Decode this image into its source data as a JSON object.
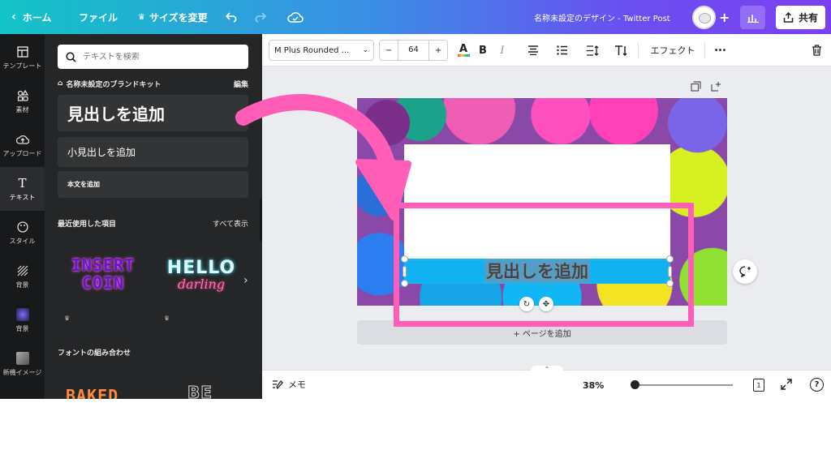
{
  "topbar": {
    "home": "ホーム",
    "file": "ファイル",
    "resize": "サイズを変更",
    "design_title": "名称未設定のデザイン - Twitter Post",
    "share": "共有"
  },
  "rail": {
    "items": [
      {
        "label": "テンプレート",
        "icon": "template-icon"
      },
      {
        "label": "素材",
        "icon": "elements-icon"
      },
      {
        "label": "アップロード",
        "icon": "upload-icon"
      },
      {
        "label": "テキスト",
        "icon": "text-icon"
      },
      {
        "label": "スタイル",
        "icon": "palette-icon"
      },
      {
        "label": "背景",
        "icon": "background-icon"
      },
      {
        "label": "背景",
        "icon": "background2-icon"
      },
      {
        "label": "新機イメージ",
        "icon": "image-icon"
      }
    ],
    "active_index": 3
  },
  "panel": {
    "search_placeholder": "テキストを検索",
    "brand_kit": "名称未設定のブランドキット",
    "edit": "編集",
    "add_heading": "見出しを追加",
    "add_subheading": "小見出しを追加",
    "add_body": "本文を追加",
    "recent": "最近使用した項目",
    "show_all": "すべて表示",
    "tile_insert": "INSERT COIN",
    "tile_hello_1": "HELLO",
    "tile_hello_2": "darling",
    "font_combos": "フォントの組み合わせ",
    "tile_baked": "BAKED",
    "tile_be": "BE"
  },
  "toolbar": {
    "font_name": "M Plus Rounded ...",
    "font_size": "64",
    "minus": "−",
    "plus": "+",
    "effects": "エフェクト",
    "more": "•••"
  },
  "canvas": {
    "heading_text": "見出しを追加",
    "add_page": "+ ページを追加"
  },
  "bottombar": {
    "notes": "メモ",
    "zoom": "38%",
    "page_count": "1"
  },
  "colors": {
    "accent_pink": "#ff5db8",
    "topbar_start": "#13c4c6",
    "topbar_end": "#7b3ff2"
  }
}
